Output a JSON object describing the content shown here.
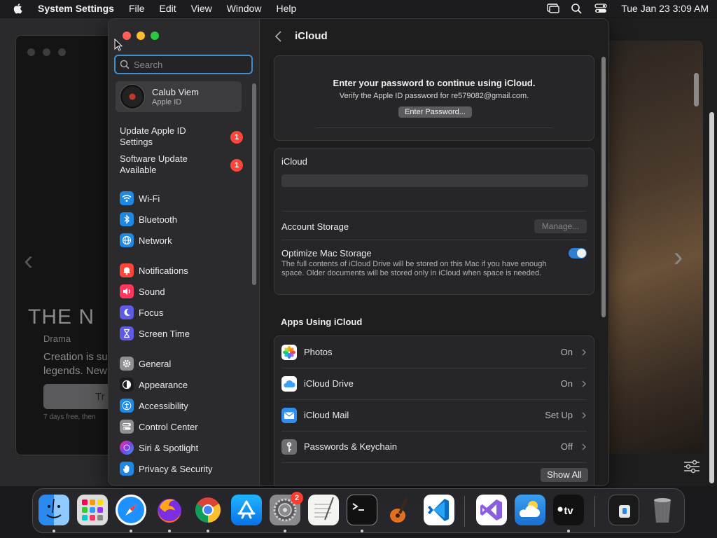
{
  "menubar": {
    "app_name": "System Settings",
    "items": [
      "File",
      "Edit",
      "View",
      "Window",
      "Help"
    ],
    "datetime": "Tue Jan 23  3:09 AM"
  },
  "background_app": {
    "title_fragment": "THE N",
    "genre": "Drama",
    "description_fragment": "Creation is su legends. New",
    "button_fragment": "Tr",
    "trial_fragment": "7 days free, then"
  },
  "sidebar": {
    "search_placeholder": "Search",
    "account": {
      "name": "Calub Viem",
      "subtitle": "Apple ID"
    },
    "notices": [
      {
        "label": "Update Apple ID Settings",
        "badge": "1"
      },
      {
        "label": "Software Update Available",
        "badge": "1"
      }
    ],
    "items": [
      {
        "label": "Wi-Fi",
        "icon": "wifi-icon",
        "color": "#1e88e5"
      },
      {
        "label": "Bluetooth",
        "icon": "bluetooth-icon",
        "color": "#1e88e5"
      },
      {
        "label": "Network",
        "icon": "globe-icon",
        "color": "#1e88e5"
      },
      {
        "label": "Notifications",
        "icon": "bell-icon",
        "color": "#ff453a"
      },
      {
        "label": "Sound",
        "icon": "speaker-icon",
        "color": "#ff375f"
      },
      {
        "label": "Focus",
        "icon": "moon-icon",
        "color": "#5e5ce6"
      },
      {
        "label": "Screen Time",
        "icon": "hourglass-icon",
        "color": "#5e5ce6"
      },
      {
        "label": "General",
        "icon": "gear-icon",
        "color": "#8e8e93"
      },
      {
        "label": "Appearance",
        "icon": "appearance-icon",
        "color": "#1c1c1e"
      },
      {
        "label": "Accessibility",
        "icon": "accessibility-icon",
        "color": "#1e88e5"
      },
      {
        "label": "Control Center",
        "icon": "control-center-icon",
        "color": "#8e8e93"
      },
      {
        "label": "Siri & Spotlight",
        "icon": "siri-icon",
        "color": "#7b3fe4"
      },
      {
        "label": "Privacy & Security",
        "icon": "hand-icon",
        "color": "#1e88e5"
      }
    ]
  },
  "main": {
    "title": "iCloud",
    "password_prompt": {
      "title": "Enter your password to continue using iCloud.",
      "subtitle": "Verify the Apple ID password for re579082@gmail.com.",
      "button": "Enter Password..."
    },
    "icloud_card": {
      "label": "iCloud",
      "account_storage_label": "Account Storage",
      "manage_button": "Manage...",
      "optimize_label": "Optimize Mac Storage",
      "optimize_desc": "The full contents of iCloud Drive will be stored on this Mac if you have enough space. Older documents will be stored only in iCloud when space is needed.",
      "optimize_enabled": true
    },
    "apps_section_title": "Apps Using iCloud",
    "apps": [
      {
        "name": "Photos",
        "status": "On",
        "icon": "photos-icon"
      },
      {
        "name": "iCloud Drive",
        "status": "On",
        "icon": "cloud-icon"
      },
      {
        "name": "iCloud Mail",
        "status": "Set Up",
        "icon": "mail-icon"
      },
      {
        "name": "Passwords & Keychain",
        "status": "Off",
        "icon": "key-icon"
      }
    ],
    "show_all_button": "Show All"
  },
  "dock": {
    "apps": [
      "Finder",
      "Launchpad",
      "Safari",
      "Firefox",
      "Chrome",
      "App Store",
      "System Settings",
      "TextEdit",
      "Terminal",
      "GarageBand",
      "Visual Studio Code",
      "Visual Studio",
      "Weather",
      "TV",
      "Downloads",
      "Trash"
    ],
    "settings_badge": "2"
  }
}
